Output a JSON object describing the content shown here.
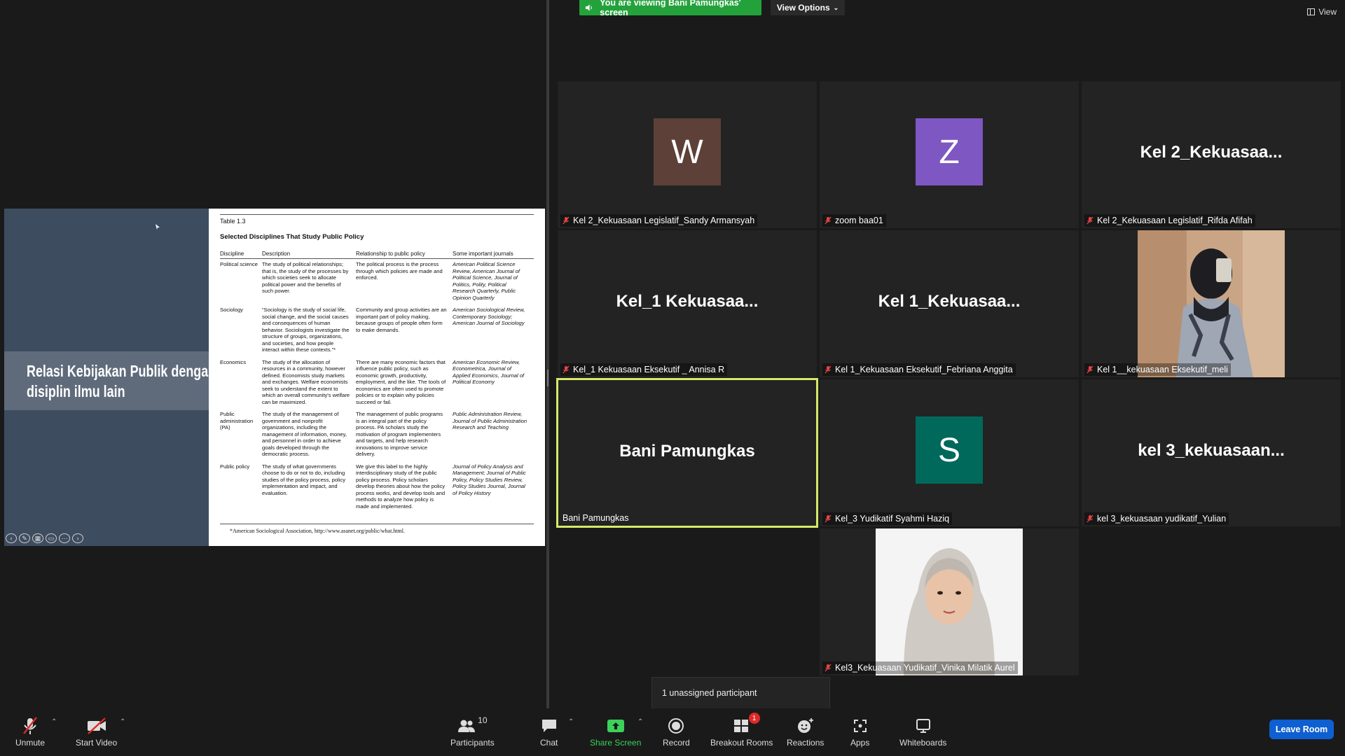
{
  "colors": {
    "background": "#1a1a1a",
    "tile": "#232323",
    "banner_green": "#23a23b",
    "active_border": "#d6e96a",
    "leave_blue": "#0e5fd1",
    "avatar_w": "#5d4037",
    "avatar_z": "#7e57c2",
    "avatar_s": "#00695c"
  },
  "banner": {
    "viewing_text": "You are viewing Bani Pamungkas' screen",
    "view_options": "View Options",
    "view_label": "View"
  },
  "slide": {
    "title_line1": "Relasi Kebijakan Publik dengan",
    "title_line2": "disiplin ilmu lain",
    "table_label": "Table 1.3",
    "table_title": "Selected Disciplines That Study Public Policy",
    "headers": [
      "Discipline",
      "Description",
      "Relationship to public policy",
      "Some important journals"
    ],
    "rows": [
      {
        "discipline": "Political science",
        "description": "The study of political relationships; that is, the study of the processes by which societies seek to allocate political power and the benefits of such power.",
        "relationship": "The political process is the process through which policies are made and enforced.",
        "journals": "American Political Science Review, American Journal of Political Science, Journal of Politics, Polity, Political Research Quarterly, Public Opinion Quarterly"
      },
      {
        "discipline": "Sociology",
        "description": "“Sociology is the study of social life, social change, and the social causes and consequences of human behavior. Sociologists investigate the structure of groups, organizations, and societies, and how people interact within these contexts.”*",
        "relationship": "Community and group activities are an important part of policy making, because groups of people often form to make demands.",
        "journals": "American Sociological Review, Contemporary Sociology; American Journal of Sociology"
      },
      {
        "discipline": "Economics",
        "description": "The study of the allocation of resources in a community, however defined. Economists study markets and exchanges. Welfare economists seek to understand the extent to which an overall community's welfare can be maximized.",
        "relationship": "There are many economic factors that influence public policy, such as economic growth, productivity, employment, and the like. The tools of economics are often used to promote policies or to explain why policies succeed or fail.",
        "journals": "American Economic Review, Econometrica, Journal of Applied Economics, Journal of Political Economy"
      },
      {
        "discipline": "Public administration (PA)",
        "description": "The study of the management of government and nonprofit organizations, including the management of information, money, and personnel in order to achieve goals developed through the democratic process.",
        "relationship": "The management of public programs is an integral part of the policy process. PA scholars study the motivation of program implementers and targets, and help research innovations to improve service delivery.",
        "journals": "Public Administration Review, Journal of Public Administration Research and Teaching"
      },
      {
        "discipline": "Public policy",
        "description": "The study of what governments choose to do or not to do, including studies of the policy process, policy implementation and impact, and evaluation.",
        "relationship": "We give this label to the highly interdisciplinary study of the public policy process. Policy scholars develop theories about how the policy process works, and develop tools and methods to analyze how policy is made and implemented.",
        "journals": "Journal of Policy Analysis and Management; Journal of Public Policy, Policy Studies Review, Policy Studies Journal, Journal of Policy History"
      }
    ],
    "footnote": "*American Sociological Association, http://www.asanet.org/public/what.html."
  },
  "tiles": [
    {
      "name": "Kel 2_Kekuasaan Legislatif_Sandy Armansyah",
      "avatar": "W"
    },
    {
      "name": "zoom baa01",
      "avatar": "Z"
    },
    {
      "name": "Kel 2_Kekuasaan Legislatif_Rifda Afifah",
      "display": "Kel  2_Kekuasaa..."
    },
    {
      "name": "Kel_1 Kekuasaan Eksekutif _ Annisa R",
      "display": "Kel_1  Kekuasaa..."
    },
    {
      "name": "Kel 1_Kekuasaan Eksekutif_Febriana Anggita",
      "display": "Kel  1_Kekuasaa..."
    },
    {
      "name": "Kel 1__kekuasaan Eksekutif_meli"
    },
    {
      "name": "Bani Pamungkas",
      "display": "Bani Pamungkas"
    },
    {
      "name": "Kel_3 Yudikatif Syahmi Haziq",
      "avatar": "S"
    },
    {
      "name": "kel 3_kekuasaan yudikatif_Yulian",
      "display": "kel  3_kekuasaan..."
    },
    {
      "name": "Kel3_Kekuasaan Yudikatif_Vinika Milatik Aurel"
    }
  ],
  "tooltip": {
    "unassigned": "1 unassigned participant"
  },
  "toolbar": {
    "unmute": "Unmute",
    "start_video": "Start Video",
    "participants": "Participants",
    "participant_count": "10",
    "chat": "Chat",
    "share_screen": "Share Screen",
    "record": "Record",
    "breakout_rooms": "Breakout Rooms",
    "breakout_badge": "1",
    "reactions": "Reactions",
    "apps": "Apps",
    "whiteboards": "Whiteboards",
    "leave_room": "Leave Room"
  }
}
